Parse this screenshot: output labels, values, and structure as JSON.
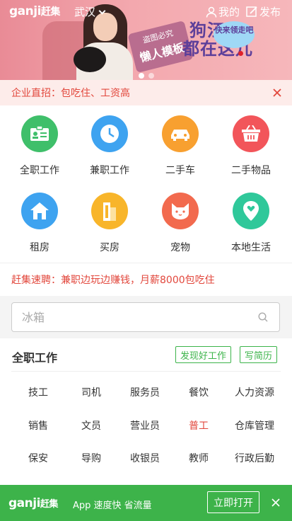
{
  "header": {
    "logo": "ganji",
    "logo_cn": "赶集",
    "city": "武汉",
    "mine": "我的",
    "post": "发布"
  },
  "banner": {
    "panel_small": "盗图必究",
    "panel_big": "懒人模板",
    "headline_1": "狗汪",
    "headline_2": "都在这儿",
    "bubble": "快来领走吧"
  },
  "notice": {
    "text": "企业直招：包吃住、工资高"
  },
  "categories": [
    {
      "label": "全职工作",
      "icon": "id-card-icon",
      "color": "#3fbf6a"
    },
    {
      "label": "兼职工作",
      "icon": "clock-icon",
      "color": "#3ea3f0"
    },
    {
      "label": "二手车",
      "icon": "car-icon",
      "color": "#f8a030"
    },
    {
      "label": "二手物品",
      "icon": "basket-icon",
      "color": "#f2555a"
    },
    {
      "label": "租房",
      "icon": "house-icon",
      "color": "#3ea3f0"
    },
    {
      "label": "买房",
      "icon": "building-icon",
      "color": "#f8b52a"
    },
    {
      "label": "宠物",
      "icon": "cat-icon",
      "color": "#f26a4e"
    },
    {
      "label": "本地生活",
      "icon": "map-pin-icon",
      "color": "#2fc89a"
    }
  ],
  "promo": {
    "text": "赶集速聘：兼职边玩边赚钱，月薪8000包吃住"
  },
  "search": {
    "placeholder": "冰箱"
  },
  "jobs": {
    "title": "全职工作",
    "discover": "发现好工作",
    "resume": "写简历",
    "rows": [
      [
        "技工",
        "司机",
        "服务员",
        "餐饮",
        "人力资源"
      ],
      [
        "销售",
        "文员",
        "营业员",
        "普工",
        "仓库管理"
      ],
      [
        "保安",
        "导购",
        "收银员",
        "教师",
        "行政后勤"
      ]
    ],
    "highlight": "普工"
  },
  "appbar": {
    "logo": "ganji",
    "logo_cn": "赶集",
    "slogan": "App 速度快 省流量",
    "open": "立即打开"
  },
  "colors": {
    "brand_green": "#3db34a",
    "alert_red": "#e2473c"
  }
}
